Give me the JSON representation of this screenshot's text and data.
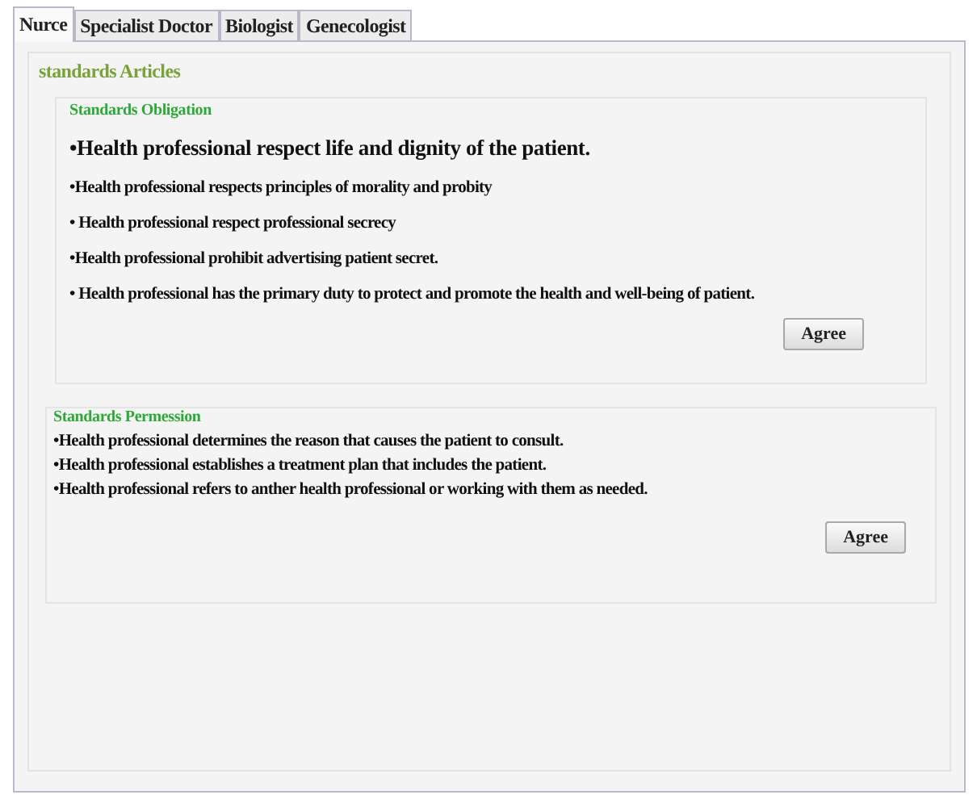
{
  "tabs": [
    {
      "label": "Nurce",
      "selected": true
    },
    {
      "label": "Specialist Doctor",
      "selected": false
    },
    {
      "label": "Biologist",
      "selected": false
    },
    {
      "label": "Genecologist",
      "selected": false
    }
  ],
  "articles": {
    "title": "standards Articles",
    "groups": [
      {
        "title": "Standards Obligation",
        "kind": "spaced",
        "items": [
          "•Health professional respect life and dignity of the patient.",
          "•Health professional respects principles of morality and probity",
          "• Health professional respect professional secrecy",
          "•Health professional prohibit advertising patient secret.",
          "• Health professional has the primary duty to protect and promote the health and well-being of patient."
        ],
        "button": "Agree"
      },
      {
        "title": "Standards Permession",
        "kind": "compact",
        "items": [
          "•Health professional determines the reason that causes the patient to consult.",
          "•Health professional establishes a treatment plan that includes the patient.",
          "•Health professional refers to anther health professional or working with them as needed."
        ],
        "button": "Agree"
      }
    ]
  }
}
